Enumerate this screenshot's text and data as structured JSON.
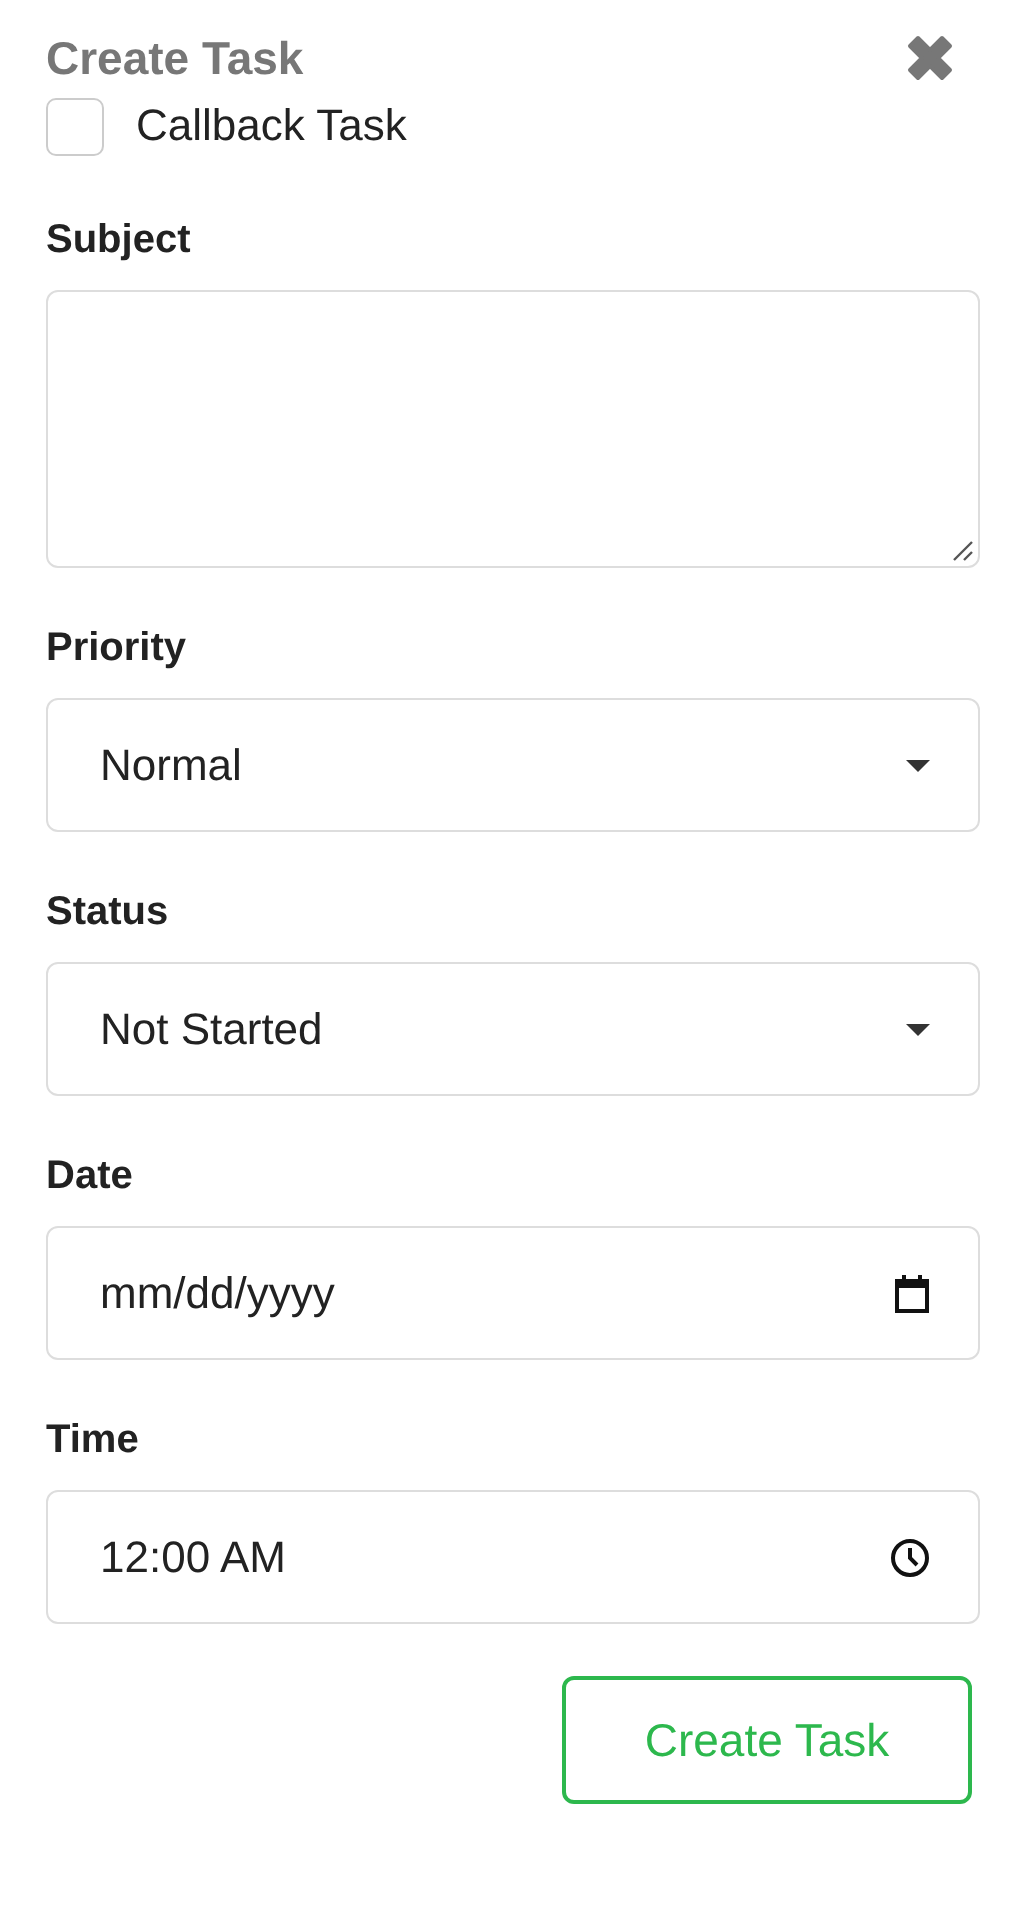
{
  "title": "Create Task",
  "callback": {
    "label": "Callback Task",
    "checked": false
  },
  "fields": [
    {
      "kind": "textarea",
      "label": "Subject"
    },
    {
      "kind": "select",
      "label": "Priority",
      "value": "Normal"
    },
    {
      "kind": "select",
      "label": "Status",
      "value": "Not Started"
    },
    {
      "kind": "date",
      "label": "Date",
      "placeholder": "mm/dd/yyyy"
    },
    {
      "kind": "time",
      "label": "Time",
      "value": "12:00 AM"
    }
  ],
  "submit": "Create Task"
}
